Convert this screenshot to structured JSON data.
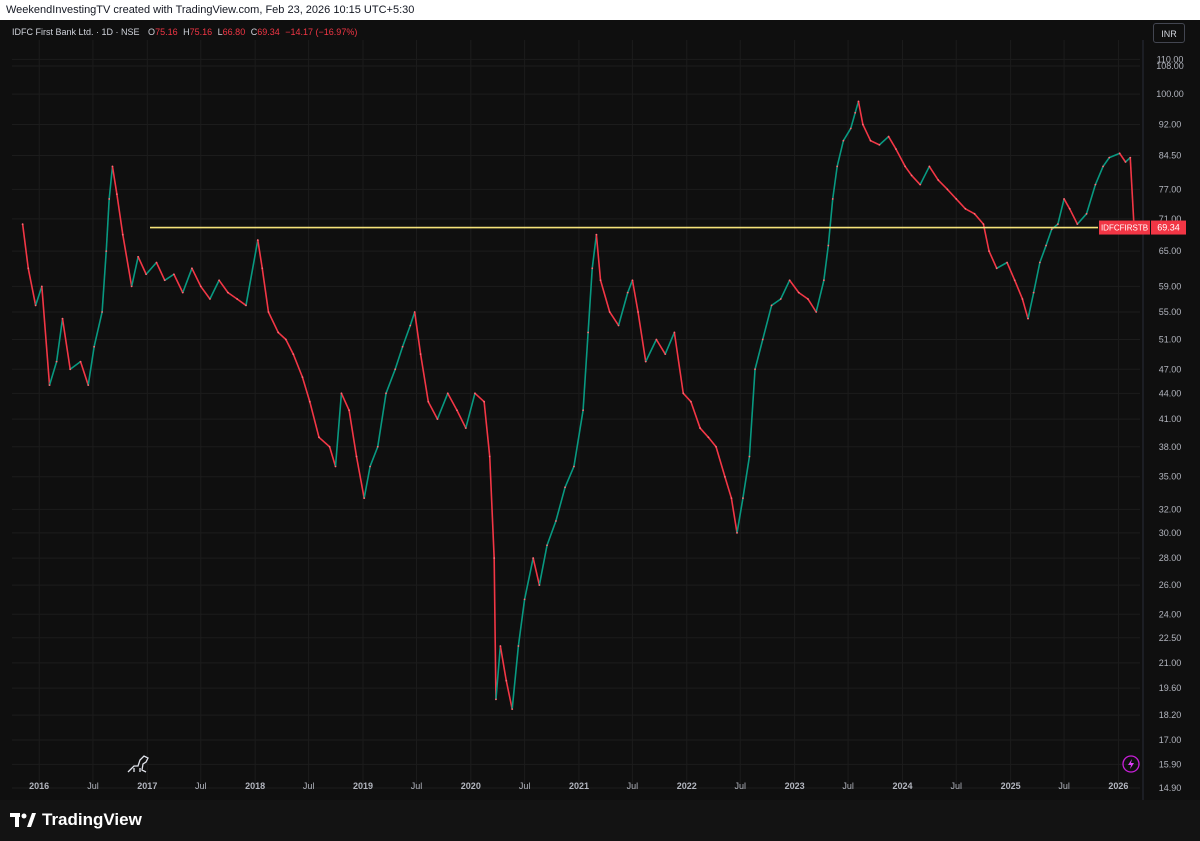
{
  "header": {
    "attribution": "WeekendInvestingTV created with TradingView.com, Feb 23, 2026 10:15 UTC+5:30"
  },
  "legend": {
    "symbol": "IDFC First Bank Ltd. · 1D · NSE",
    "o_label": "O",
    "o_value": "75.16",
    "h_label": "H",
    "h_value": "75.16",
    "l_label": "L",
    "l_value": "66.80",
    "c_label": "C",
    "c_value": "69.34",
    "change": "−14.17 (−16.97%)"
  },
  "currency_button": "INR",
  "price_tag": {
    "ticker": "IDFCFIRSTB",
    "value": "69.34"
  },
  "brand": {
    "name": "TradingView"
  },
  "colors": {
    "up": "#089981",
    "down": "#f23645",
    "hline": "#f5e27a",
    "background": "#0f0f0f"
  },
  "chart_data": {
    "type": "line",
    "title": "IDFC First Bank Ltd. · 1D · NSE",
    "y_scale": "log",
    "ylim": [
      14.9,
      116
    ],
    "y_ticks": [
      "110.00",
      "108.00",
      "100.00",
      "92.00",
      "84.50",
      "77.00",
      "71.00",
      "65.00",
      "59.00",
      "55.00",
      "51.00",
      "47.00",
      "44.00",
      "41.00",
      "38.00",
      "35.00",
      "32.00",
      "30.00",
      "28.00",
      "26.00",
      "24.00",
      "22.50",
      "21.00",
      "19.60",
      "18.20",
      "17.00",
      "15.90",
      "14.90"
    ],
    "x_ticks": [
      "2016",
      "Jul",
      "2017",
      "Jul",
      "2018",
      "Jul",
      "2019",
      "Jul",
      "2020",
      "Jul",
      "2021",
      "Jul",
      "2022",
      "Jul",
      "2023",
      "Jul",
      "2024",
      "Jul",
      "2025",
      "Jul",
      "2026"
    ],
    "xlim": [
      "2015-10-01",
      "2026-03-15"
    ],
    "horizontal_line": 69.34,
    "series": [
      {
        "values": [
          [
            "2015-11-06",
            70
          ],
          [
            "2015-11-25",
            62
          ],
          [
            "2015-12-20",
            56
          ],
          [
            "2016-01-10",
            59
          ],
          [
            "2016-02-05",
            45
          ],
          [
            "2016-02-29",
            48
          ],
          [
            "2016-03-20",
            54
          ],
          [
            "2016-04-15",
            47
          ],
          [
            "2016-05-20",
            48
          ],
          [
            "2016-06-15",
            45
          ],
          [
            "2016-07-05",
            50
          ],
          [
            "2016-08-01",
            55
          ],
          [
            "2016-08-15",
            65
          ],
          [
            "2016-08-25",
            75
          ],
          [
            "2016-09-05",
            82
          ],
          [
            "2016-09-20",
            76
          ],
          [
            "2016-10-10",
            68
          ],
          [
            "2016-11-09",
            59
          ],
          [
            "2016-12-01",
            64
          ],
          [
            "2016-12-28",
            61
          ],
          [
            "2017-02-01",
            63
          ],
          [
            "2017-03-01",
            60
          ],
          [
            "2017-04-01",
            61
          ],
          [
            "2017-05-01",
            58
          ],
          [
            "2017-06-01",
            62
          ],
          [
            "2017-07-01",
            59
          ],
          [
            "2017-08-01",
            57
          ],
          [
            "2017-09-01",
            60
          ],
          [
            "2017-10-01",
            58
          ],
          [
            "2017-11-01",
            57
          ],
          [
            "2017-12-01",
            56
          ],
          [
            "2018-01-10",
            67
          ],
          [
            "2018-01-25",
            62
          ],
          [
            "2018-02-15",
            55
          ],
          [
            "2018-03-20",
            52
          ],
          [
            "2018-04-15",
            51
          ],
          [
            "2018-05-10",
            49
          ],
          [
            "2018-06-10",
            46
          ],
          [
            "2018-07-05",
            43
          ],
          [
            "2018-08-05",
            39
          ],
          [
            "2018-09-10",
            38
          ],
          [
            "2018-09-30",
            36
          ],
          [
            "2018-10-20",
            44
          ],
          [
            "2018-11-15",
            42
          ],
          [
            "2018-12-10",
            37
          ],
          [
            "2019-01-05",
            33
          ],
          [
            "2019-01-25",
            36
          ],
          [
            "2019-02-20",
            38
          ],
          [
            "2019-03-20",
            44
          ],
          [
            "2019-04-20",
            47
          ],
          [
            "2019-05-15",
            50
          ],
          [
            "2019-06-10",
            53
          ],
          [
            "2019-06-25",
            55
          ],
          [
            "2019-07-15",
            49
          ],
          [
            "2019-08-10",
            43
          ],
          [
            "2019-09-10",
            41
          ],
          [
            "2019-10-15",
            44
          ],
          [
            "2019-11-15",
            42
          ],
          [
            "2019-12-15",
            40
          ],
          [
            "2020-01-15",
            44
          ],
          [
            "2020-02-15",
            43
          ],
          [
            "2020-03-05",
            37
          ],
          [
            "2020-03-20",
            28
          ],
          [
            "2020-03-26",
            19
          ],
          [
            "2020-04-10",
            22
          ],
          [
            "2020-04-30",
            20
          ],
          [
            "2020-05-20",
            18.5
          ],
          [
            "2020-06-10",
            22
          ],
          [
            "2020-07-01",
            25
          ],
          [
            "2020-07-30",
            28
          ],
          [
            "2020-08-20",
            26
          ],
          [
            "2020-09-15",
            29
          ],
          [
            "2020-10-15",
            31
          ],
          [
            "2020-11-15",
            34
          ],
          [
            "2020-12-15",
            36
          ],
          [
            "2021-01-15",
            42
          ],
          [
            "2021-02-01",
            52
          ],
          [
            "2021-02-15",
            62
          ],
          [
            "2021-03-01",
            68
          ],
          [
            "2021-03-15",
            60
          ],
          [
            "2021-04-15",
            55
          ],
          [
            "2021-05-15",
            53
          ],
          [
            "2021-06-15",
            58
          ],
          [
            "2021-07-01",
            60
          ],
          [
            "2021-07-20",
            55
          ],
          [
            "2021-08-15",
            48
          ],
          [
            "2021-09-20",
            51
          ],
          [
            "2021-10-20",
            49
          ],
          [
            "2021-11-20",
            52
          ],
          [
            "2021-12-20",
            44
          ],
          [
            "2022-01-15",
            43
          ],
          [
            "2022-02-15",
            40
          ],
          [
            "2022-03-15",
            39
          ],
          [
            "2022-04-10",
            38
          ],
          [
            "2022-05-10",
            35
          ],
          [
            "2022-06-01",
            33
          ],
          [
            "2022-06-20",
            30
          ],
          [
            "2022-07-10",
            33
          ],
          [
            "2022-08-01",
            37
          ],
          [
            "2022-08-20",
            47
          ],
          [
            "2022-09-15",
            51
          ],
          [
            "2022-10-15",
            56
          ],
          [
            "2022-11-15",
            57
          ],
          [
            "2022-12-15",
            60
          ],
          [
            "2023-01-15",
            58
          ],
          [
            "2023-02-15",
            57
          ],
          [
            "2023-03-15",
            55
          ],
          [
            "2023-04-10",
            60
          ],
          [
            "2023-04-25",
            66
          ],
          [
            "2023-05-10",
            75
          ],
          [
            "2023-05-25",
            82
          ],
          [
            "2023-06-15",
            88
          ],
          [
            "2023-07-10",
            91
          ],
          [
            "2023-07-25",
            95
          ],
          [
            "2023-08-05",
            98
          ],
          [
            "2023-08-20",
            92
          ],
          [
            "2023-09-15",
            88
          ],
          [
            "2023-10-15",
            87
          ],
          [
            "2023-11-15",
            89
          ],
          [
            "2023-12-10",
            86
          ],
          [
            "2024-01-10",
            82
          ],
          [
            "2024-02-01",
            80
          ],
          [
            "2024-03-01",
            78
          ],
          [
            "2024-04-01",
            82
          ],
          [
            "2024-05-01",
            79
          ],
          [
            "2024-06-01",
            77
          ],
          [
            "2024-07-01",
            75
          ],
          [
            "2024-08-01",
            73
          ],
          [
            "2024-09-01",
            72
          ],
          [
            "2024-10-01",
            70
          ],
          [
            "2024-10-20",
            65
          ],
          [
            "2024-11-15",
            62
          ],
          [
            "2024-12-20",
            63
          ],
          [
            "2025-01-15",
            60
          ],
          [
            "2025-02-10",
            57
          ],
          [
            "2025-03-01",
            54
          ],
          [
            "2025-03-20",
            58
          ],
          [
            "2025-04-10",
            63
          ],
          [
            "2025-05-01",
            66
          ],
          [
            "2025-05-20",
            69
          ],
          [
            "2025-06-10",
            70
          ],
          [
            "2025-07-01",
            75
          ],
          [
            "2025-07-20",
            73
          ],
          [
            "2025-08-15",
            70
          ],
          [
            "2025-09-15",
            72
          ],
          [
            "2025-10-15",
            78
          ],
          [
            "2025-11-10",
            82
          ],
          [
            "2025-12-01",
            84
          ],
          [
            "2026-01-05",
            85
          ],
          [
            "2026-01-25",
            83
          ],
          [
            "2026-02-10",
            84
          ],
          [
            "2026-02-23",
            69.34
          ]
        ]
      }
    ]
  }
}
